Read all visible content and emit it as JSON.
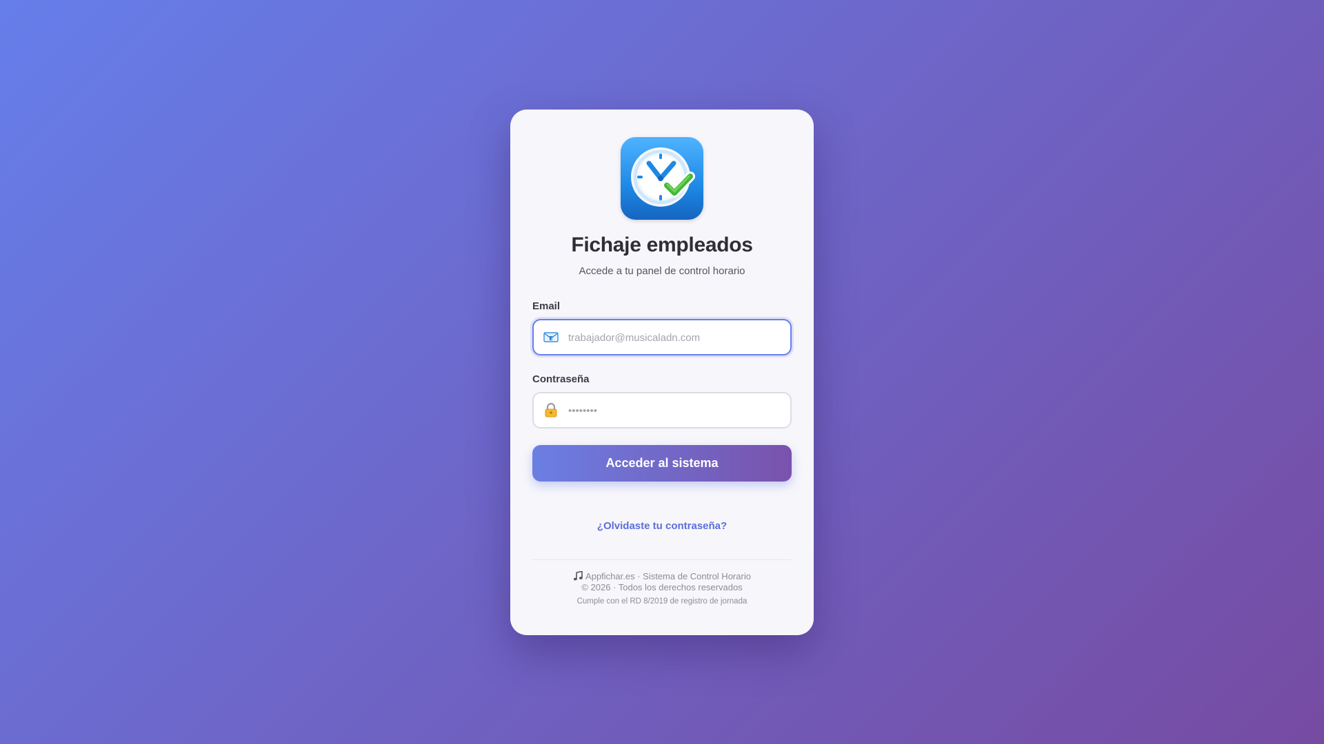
{
  "app": {
    "title": "Fichaje empleados",
    "subtitle": "Accede a tu panel de control horario",
    "logo_icon": "clock-check-icon"
  },
  "form": {
    "email": {
      "label": "Email",
      "placeholder": "trabajador@musicaladn.com",
      "value": "",
      "icon": "email-icon"
    },
    "password": {
      "label": "Contraseña",
      "placeholder": "••••••••",
      "value": "",
      "icon": "lock-icon"
    },
    "submit_label": "Acceder al sistema"
  },
  "links": {
    "forgot_password": "¿Olvidaste tu contraseña?"
  },
  "footer": {
    "brand": "Appfichar.es · Sistema de Control Horario",
    "copyright": "© 2026 · Todos los derechos reservados",
    "compliance": "Cumple con el RD 8/2019 de registro de jornada",
    "brand_icon": "music-note-icon"
  },
  "colors": {
    "gradient_start": "#667eea",
    "gradient_end": "#764ba2",
    "accent": "#667eea",
    "link": "#5b6fd9"
  }
}
